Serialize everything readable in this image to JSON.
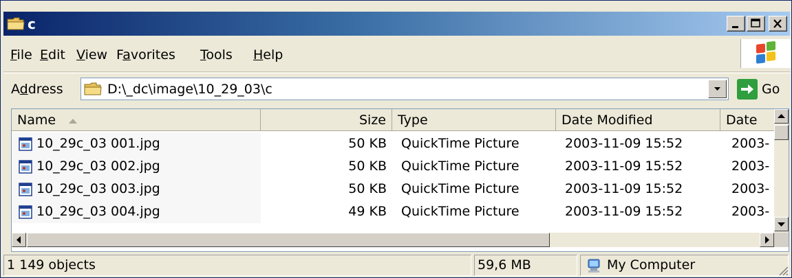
{
  "window": {
    "title": "c",
    "icon": "folder-icon",
    "controls": [
      "minimize-icon",
      "maximize-icon",
      "close-icon"
    ]
  },
  "menu": {
    "items": [
      {
        "label": "File",
        "accel": "F"
      },
      {
        "label": "Edit",
        "accel": "E"
      },
      {
        "label": "View",
        "accel": "V"
      },
      {
        "label": "Favorites",
        "accel": "a"
      },
      {
        "label": "Tools",
        "accel": "T"
      },
      {
        "label": "Help",
        "accel": "H"
      }
    ]
  },
  "address": {
    "label": "Address",
    "value": "D:\\_dc\\image\\10_29_03\\c",
    "go_label": "Go"
  },
  "list": {
    "columns": [
      "Name",
      "Size",
      "Type",
      "Date Modified",
      "Date"
    ],
    "sort_column": "Name",
    "sort_direction": "ascending",
    "rows": [
      {
        "name": "10_29c_03 001.jpg",
        "size": "50 KB",
        "type": "QuickTime Picture",
        "modified": "2003-11-09 15:52",
        "date": "2003-"
      },
      {
        "name": "10_29c_03 002.jpg",
        "size": "50 KB",
        "type": "QuickTime Picture",
        "modified": "2003-11-09 15:52",
        "date": "2003-"
      },
      {
        "name": "10_29c_03 003.jpg",
        "size": "50 KB",
        "type": "QuickTime Picture",
        "modified": "2003-11-09 15:52",
        "date": "2003-"
      },
      {
        "name": "10_29c_03 004.jpg",
        "size": "49 KB",
        "type": "QuickTime Picture",
        "modified": "2003-11-09 15:52",
        "date": "2003-"
      }
    ]
  },
  "status": {
    "objects": "1 149 objects",
    "size": "59,6 MB",
    "location": "My Computer"
  },
  "colors": {
    "title_gradient_start": "#0a246a",
    "title_gradient_end": "#a6caf0",
    "window_face": "#ece9d8",
    "go_green": "#2f9e3e"
  }
}
